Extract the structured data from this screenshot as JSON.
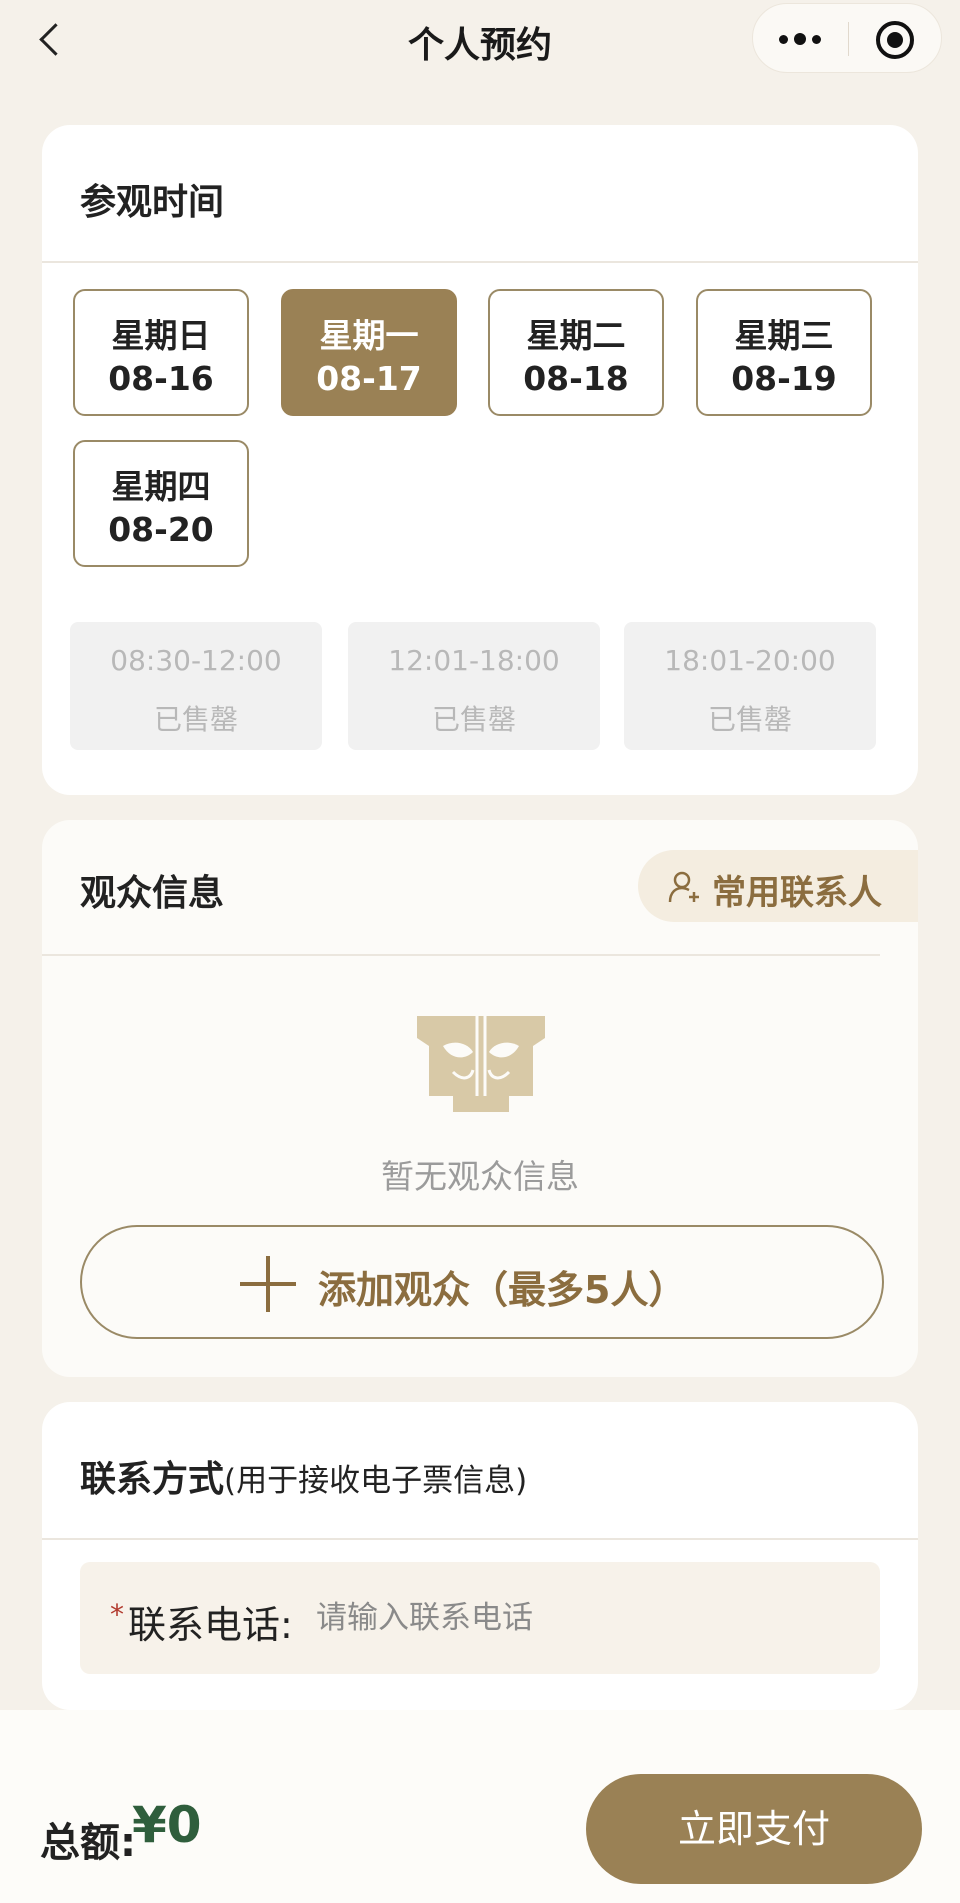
{
  "header": {
    "title": "个人预约",
    "back_icon": "chevron-left-icon",
    "more_icon": "more-dots-icon",
    "close_icon": "target-close-icon"
  },
  "visit_time": {
    "title": "参观时间",
    "dates": [
      {
        "weekday": "星期日",
        "date": "08-16",
        "selected": false
      },
      {
        "weekday": "星期一",
        "date": "08-17",
        "selected": true
      },
      {
        "weekday": "星期二",
        "date": "08-18",
        "selected": false
      },
      {
        "weekday": "星期三",
        "date": "08-19",
        "selected": false
      },
      {
        "weekday": "星期四",
        "date": "08-20",
        "selected": false
      }
    ],
    "slots": [
      {
        "time": "08:30-12:00",
        "status": "已售罄"
      },
      {
        "time": "12:01-18:00",
        "status": "已售罄"
      },
      {
        "time": "18:01-20:00",
        "status": "已售罄"
      }
    ]
  },
  "audience": {
    "title": "观众信息",
    "contacts_button": "常用联系人",
    "empty_text": "暂无观众信息",
    "add_button": "添加观众（最多5人）"
  },
  "contact": {
    "title": "联系方式",
    "title_note": "(用于接收电子票信息)",
    "required_mark": "*",
    "phone_label": "联系电话:",
    "phone_placeholder": "请输入联系电话",
    "phone_value": ""
  },
  "footer": {
    "total_label": "总额:",
    "total_value": "¥0",
    "pay_button": "立即支付"
  },
  "colors": {
    "accent": "#9a8155",
    "accent_text": "#8b6d3f",
    "price": "#2f5e3c",
    "background": "#f5f1ea"
  }
}
